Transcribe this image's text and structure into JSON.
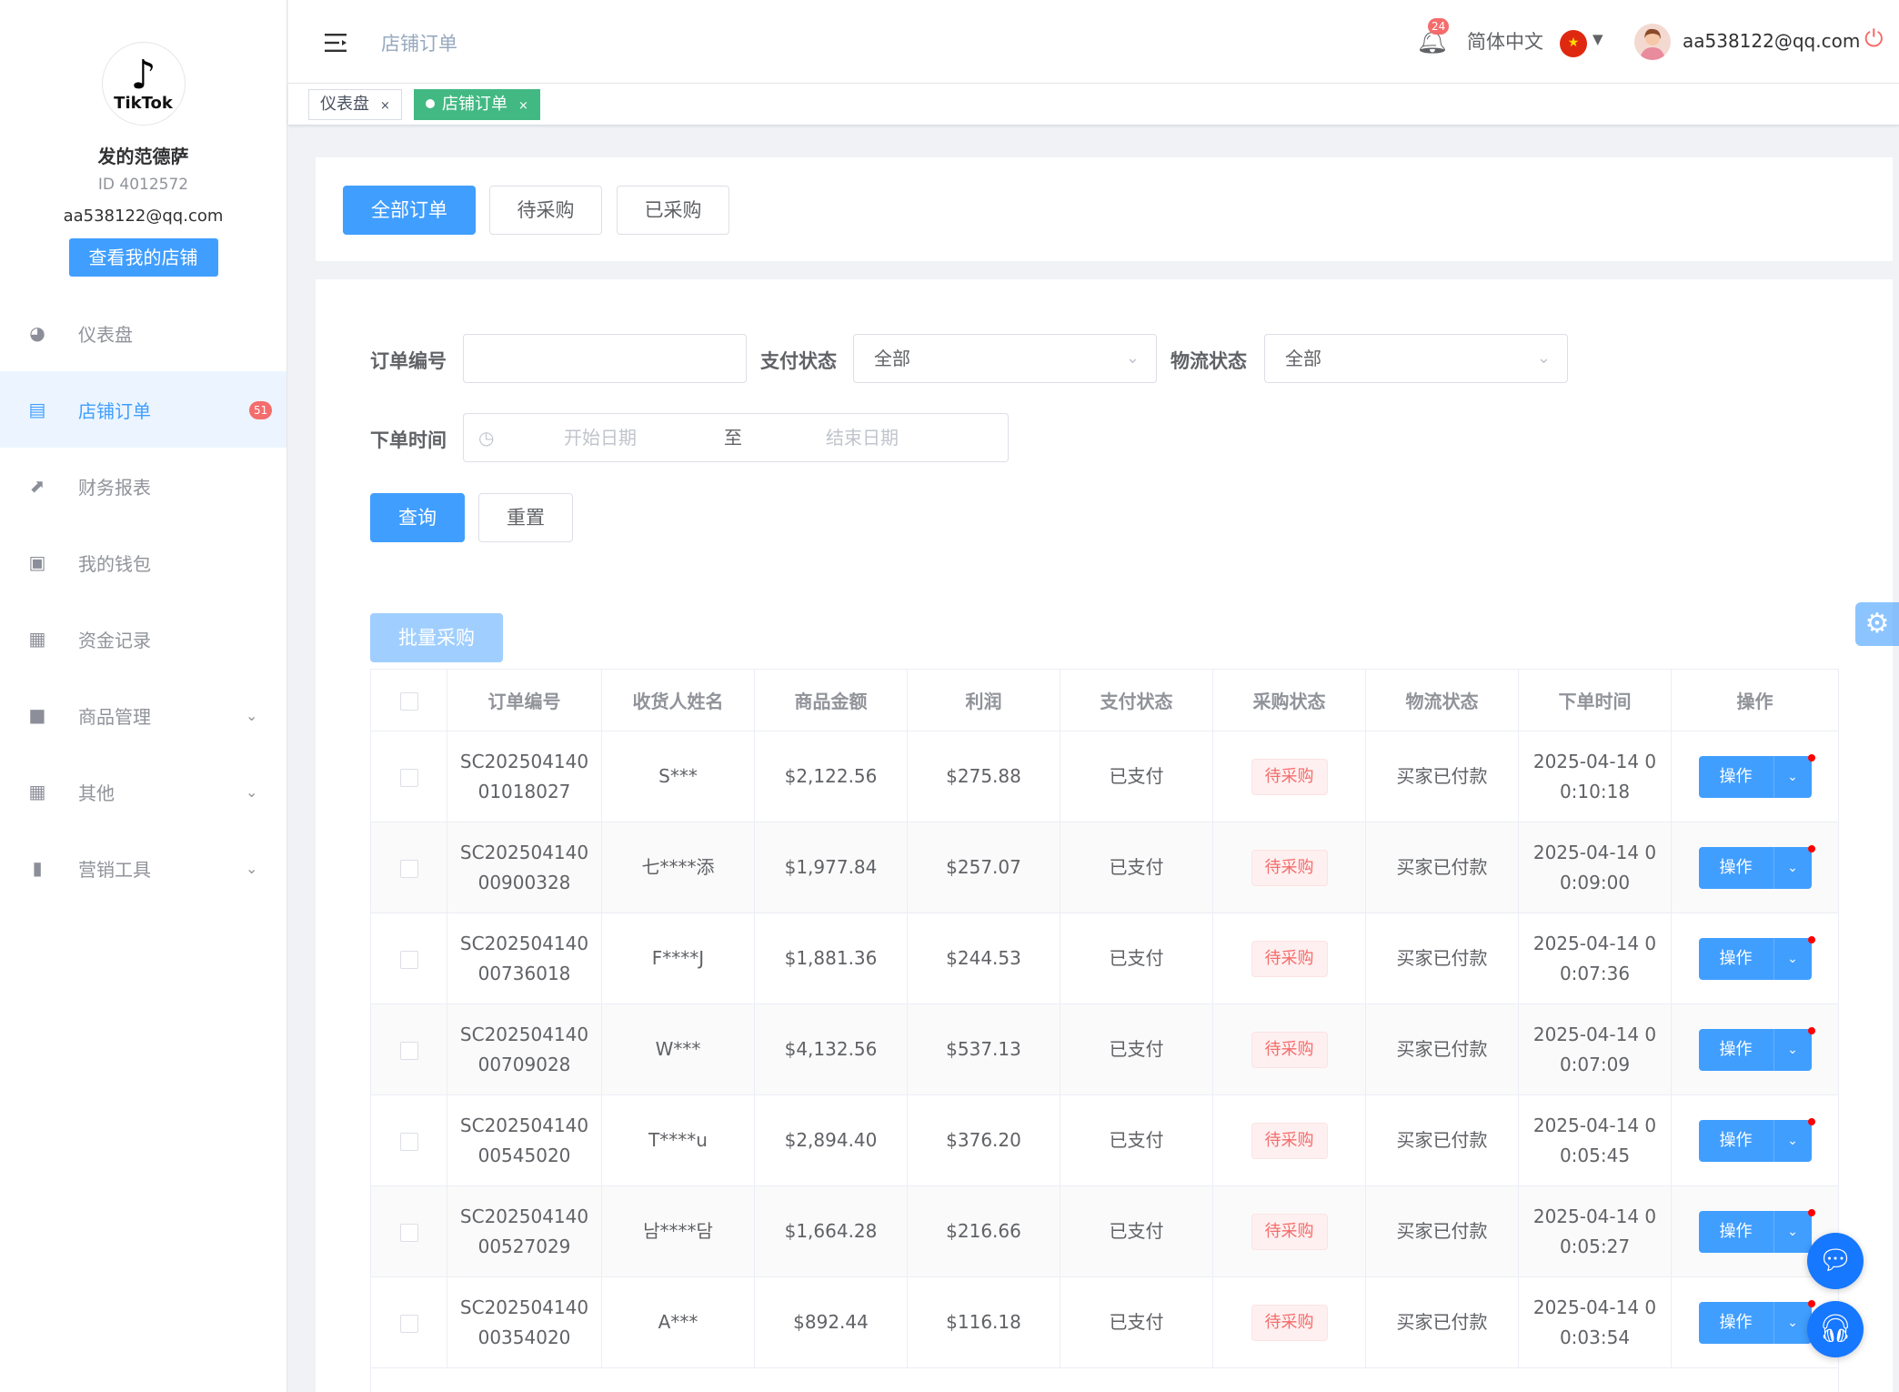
{
  "profile": {
    "name": "发的范德萨",
    "id_text": "ID 4012572",
    "email": "aa538122@qq.com",
    "view_shop": "查看我的店铺",
    "logo_text": "TikTok"
  },
  "menu": [
    {
      "label": "仪表盘",
      "icon": "dashboard-icon"
    },
    {
      "label": "店铺订单",
      "icon": "clipboard-icon",
      "badge": "51",
      "active": true
    },
    {
      "label": "财务报表",
      "icon": "chart-line-icon"
    },
    {
      "label": "我的钱包",
      "icon": "wallet-icon"
    },
    {
      "label": "资金记录",
      "icon": "document-icon"
    },
    {
      "label": "商品管理",
      "icon": "briefcase-icon",
      "expandable": true
    },
    {
      "label": "其他",
      "icon": "grid-icon",
      "expandable": true
    },
    {
      "label": "营销工具",
      "icon": "bar-chart-icon",
      "expandable": true
    }
  ],
  "header": {
    "breadcrumb": "店铺订单",
    "notif_count": "24",
    "language": "简体中文",
    "user_email": "aa538122@qq.com"
  },
  "tabs": [
    {
      "label": "仪表盘"
    },
    {
      "label": "店铺订单",
      "active": true
    }
  ],
  "order_tabs": {
    "all": "全部订单",
    "pending": "待采购",
    "purchased": "已采购"
  },
  "filters": {
    "order_no_label": "订单编号",
    "order_no_value": "",
    "pay_label": "支付状态",
    "pay_value": "全部",
    "logistics_label": "物流状态",
    "logistics_value": "全部",
    "time_label": "下单时间",
    "start_placeholder": "开始日期",
    "to": "至",
    "end_placeholder": "结束日期",
    "query": "查询",
    "reset": "重置"
  },
  "batch_button": "批量采购",
  "table": {
    "headers": [
      "订单编号",
      "收货人姓名",
      "商品金额",
      "利润",
      "支付状态",
      "采购状态",
      "物流状态",
      "下单时间",
      "操作"
    ],
    "rows": [
      {
        "order": [
          "SC202504140",
          "01018027"
        ],
        "name": "S***",
        "amount": "$2,122.56",
        "profit": "$275.88",
        "pay": "已支付",
        "purchase": "待采购",
        "logistics": "买家已付款",
        "time": [
          "2025-04-14 0",
          "0:10:18"
        ],
        "op": "操作"
      },
      {
        "order": [
          "SC202504140",
          "00900328"
        ],
        "name": "七****添",
        "amount": "$1,977.84",
        "profit": "$257.07",
        "pay": "已支付",
        "purchase": "待采购",
        "logistics": "买家已付款",
        "time": [
          "2025-04-14 0",
          "0:09:00"
        ],
        "op": "操作"
      },
      {
        "order": [
          "SC202504140",
          "00736018"
        ],
        "name": "F****J",
        "amount": "$1,881.36",
        "profit": "$244.53",
        "pay": "已支付",
        "purchase": "待采购",
        "logistics": "买家已付款",
        "time": [
          "2025-04-14 0",
          "0:07:36"
        ],
        "op": "操作"
      },
      {
        "order": [
          "SC202504140",
          "00709028"
        ],
        "name": "W***",
        "amount": "$4,132.56",
        "profit": "$537.13",
        "pay": "已支付",
        "purchase": "待采购",
        "logistics": "买家已付款",
        "time": [
          "2025-04-14 0",
          "0:07:09"
        ],
        "op": "操作"
      },
      {
        "order": [
          "SC202504140",
          "00545020"
        ],
        "name": "T****u",
        "amount": "$2,894.40",
        "profit": "$376.20",
        "pay": "已支付",
        "purchase": "待采购",
        "logistics": "买家已付款",
        "time": [
          "2025-04-14 0",
          "0:05:45"
        ],
        "op": "操作"
      },
      {
        "order": [
          "SC202504140",
          "00527029"
        ],
        "name": "남****담",
        "amount": "$1,664.28",
        "profit": "$216.66",
        "pay": "已支付",
        "purchase": "待采购",
        "logistics": "买家已付款",
        "time": [
          "2025-04-14 0",
          "0:05:27"
        ],
        "op": "操作"
      },
      {
        "order": [
          "SC202504140",
          "00354020"
        ],
        "name": "A***",
        "amount": "$892.44",
        "profit": "$116.18",
        "pay": "已支付",
        "purchase": "待采购",
        "logistics": "买家已付款",
        "time": [
          "2025-04-14 0",
          "0:03:54"
        ],
        "op": "操作"
      }
    ]
  }
}
